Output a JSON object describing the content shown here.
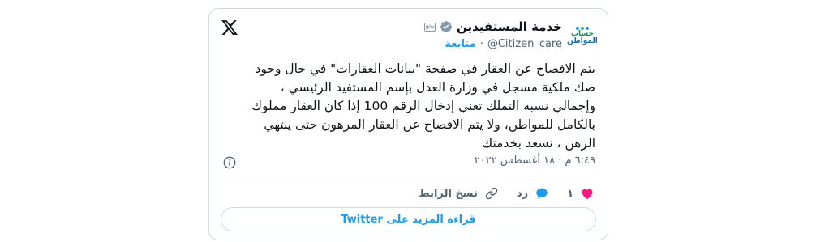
{
  "account": {
    "name": "خدمة المستفيدين",
    "handle": "@Citizen_care",
    "follow_label": "متابعة",
    "separator": "·",
    "logo_line1": "حساب",
    "logo_line2": "المواطن",
    "gov_badge_text": "gov"
  },
  "tweet": {
    "text": "يتم الافصاح عن العقار في صفحة \"بيانات العقارات\" في حال وجود صك ملكية مسجل في وزارة العدل بإسم المستفيد الرئيسي ، وإجمالي نسبة التملك تعني إدخال الرقم 100 إذا كان العقار مملوك بالكامل للمواطن، ولا يتم الافصاح عن العقار المرهون حتى ينتهي الرهن ، نسعد بخدمتك",
    "timestamp": "٦:٤٩ م · ١٨ أغسطس ٢٠٢٢"
  },
  "actions": {
    "like_count": "١",
    "reply_label": "رد",
    "copy_link_label": "نسخ الرابط"
  },
  "read_more_label": "قراءة المزيد على Twitter",
  "colors": {
    "accent": "#1d9bf0",
    "like": "#f91880",
    "text": "#0f1419",
    "muted": "#536471"
  }
}
